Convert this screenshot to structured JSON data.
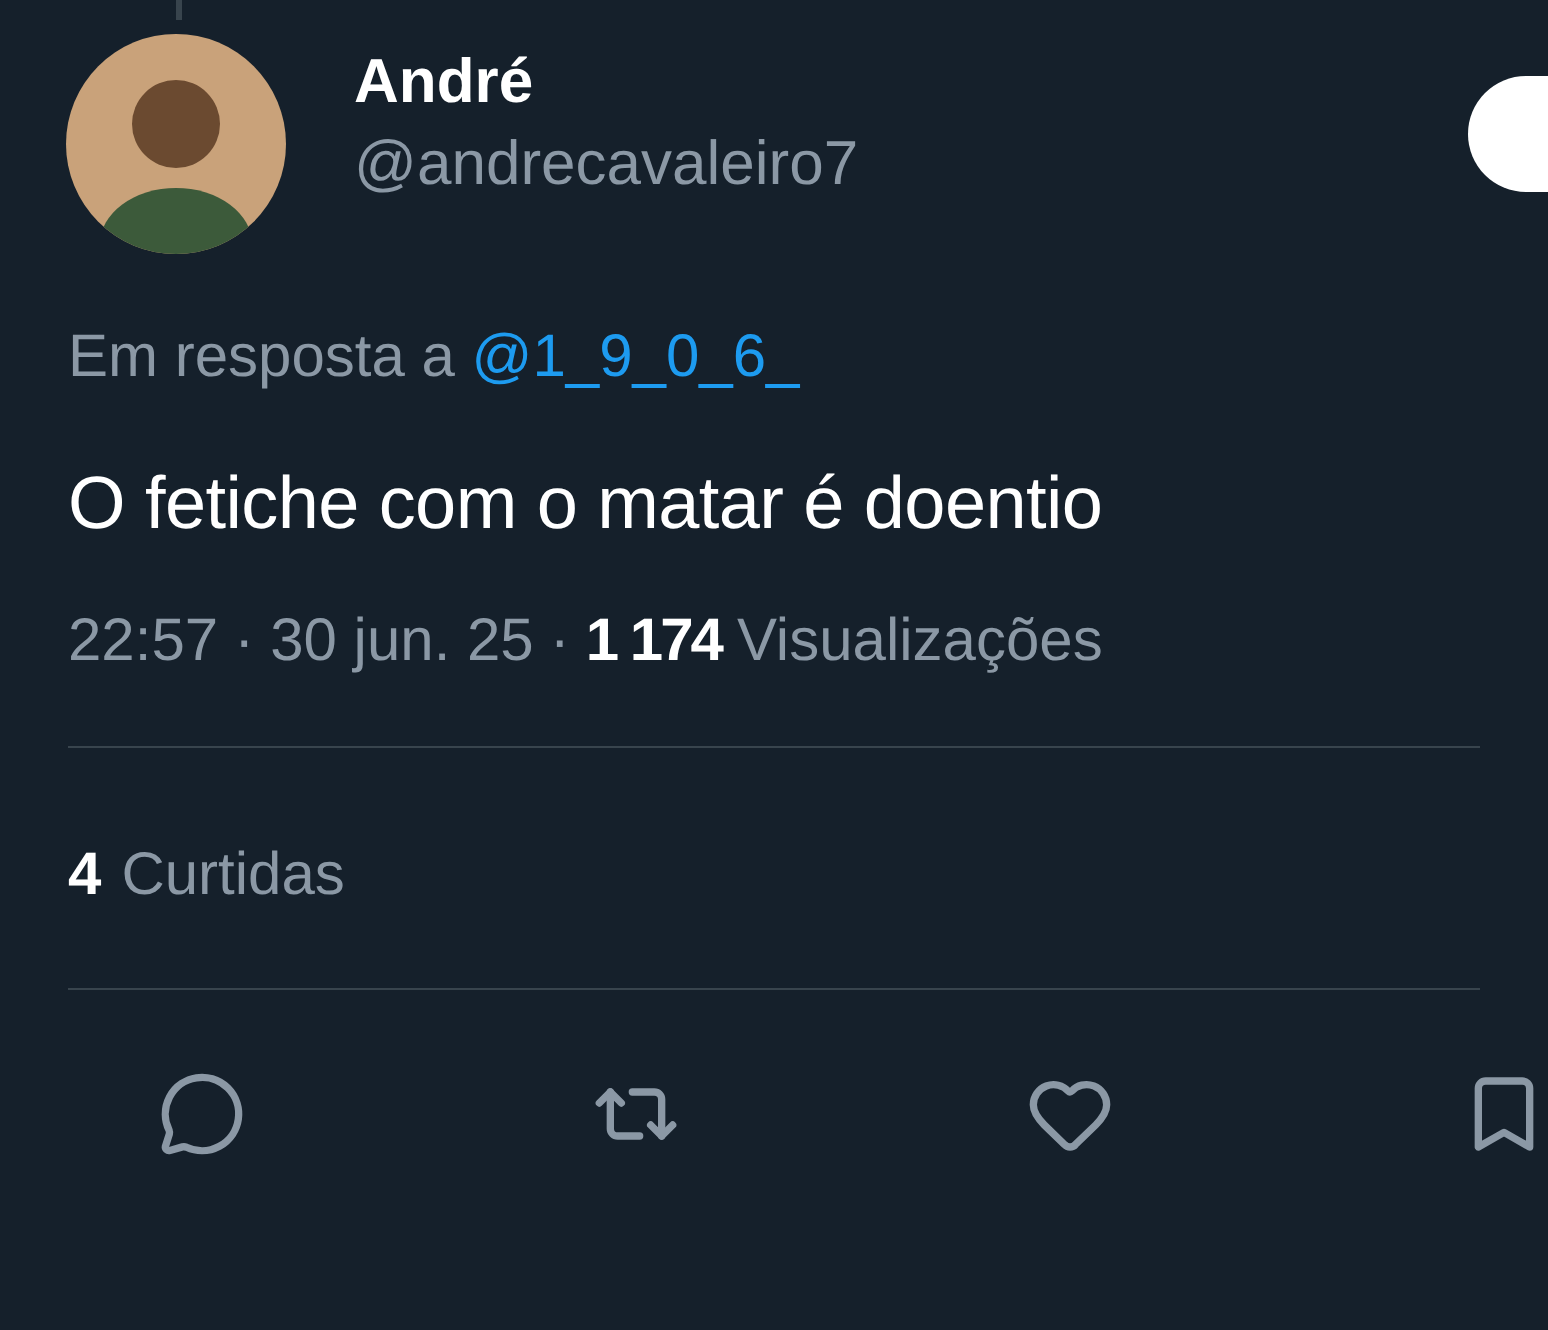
{
  "author": {
    "name": "André",
    "handle": "@andrecavaleiro7"
  },
  "reply_to": {
    "label": "Em resposta a",
    "handle": "@1_9_0_6_"
  },
  "text": "O fetiche com o matar é doentio",
  "meta": {
    "time": "22:57",
    "separator_1": "·",
    "date": "30 jun. 25",
    "separator_2": "·",
    "views_count": "1 174",
    "views_label": "Visualizações"
  },
  "likes": {
    "count": "4",
    "label": "Curtidas"
  },
  "actions": [
    {
      "kind": "reply"
    },
    {
      "kind": "repost"
    },
    {
      "kind": "like"
    },
    {
      "kind": "bookmark"
    }
  ]
}
